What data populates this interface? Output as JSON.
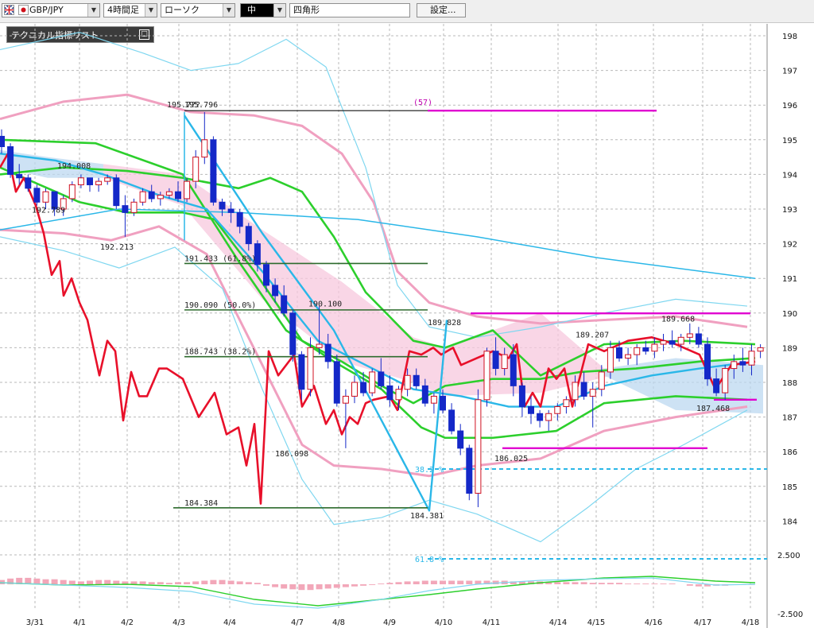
{
  "toolbar": {
    "symbol": "GBP/JPY",
    "timeframe": "4時間足",
    "chart_style": "ローソク",
    "size": "中",
    "shape": "四角形",
    "settings_label": "設定..."
  },
  "panel": {
    "label": "テクニカル指標リスト",
    "button": "□"
  },
  "chart_data": {
    "type": "candlestick",
    "x_tick_labels": [
      "3/31",
      "4/1",
      "4/2",
      "4/3",
      "4/4",
      "4/7",
      "4/8",
      "4/9",
      "4/10",
      "4/11",
      "4/14",
      "4/15",
      "4/16",
      "4/17",
      "4/18"
    ],
    "y_ticks": [
      198,
      197,
      196,
      195,
      194,
      193,
      192,
      191,
      190,
      189,
      188,
      187,
      186,
      185,
      184
    ],
    "macd_ticks": [
      "2.500",
      "-2.500"
    ],
    "price_labels": [
      {
        "text": "195.796",
        "price": 195.84
      },
      {
        "text": "195.7??",
        "price": 195.84
      },
      {
        "text": "194.008",
        "price": 194.1
      },
      {
        "text": "192.789",
        "price": 192.83
      },
      {
        "text": "192.213",
        "price": 192.1
      },
      {
        "text": "191.433 (61.8%)",
        "price": 191.43
      },
      {
        "text": "190.090 (50.0%)",
        "price": 190.09
      },
      {
        "text": "190.100",
        "price": 190.1
      },
      {
        "text": "188.743 (38.2%)",
        "price": 188.74
      },
      {
        "text": "186.098",
        "price": 186.1
      },
      {
        "text": "184.384",
        "price": 184.38
      },
      {
        "text": "184.381",
        "price": 184.35
      },
      {
        "text": "189.828",
        "price": 189.83
      },
      {
        "text": "189.207",
        "price": 189.2
      },
      {
        "text": "189.668",
        "price": 189.66
      },
      {
        "text": "186.025",
        "price": 186.05
      },
      {
        "text": "187.468",
        "price": 187.45
      },
      {
        "text": "(57)",
        "price": 195.96
      },
      {
        "text": "38.2 %",
        "price": 185.5
      },
      {
        "text": "61.8 %",
        "price": 2.6
      }
    ],
    "ohlc": [
      [
        195.1,
        195.3,
        194.6,
        194.8
      ],
      [
        194.8,
        194.9,
        193.9,
        194.0
      ],
      [
        194.0,
        194.3,
        193.7,
        193.9
      ],
      [
        193.9,
        194.0,
        193.5,
        193.6
      ],
      [
        193.6,
        193.7,
        193.1,
        193.2
      ],
      [
        193.2,
        193.6,
        193.0,
        193.5
      ],
      [
        193.5,
        193.5,
        192.8,
        193.0
      ],
      [
        193.0,
        193.4,
        192.8,
        193.3
      ],
      [
        193.3,
        193.8,
        193.2,
        193.7
      ],
      [
        193.7,
        194.0,
        193.6,
        193.9
      ],
      [
        193.9,
        193.9,
        193.5,
        193.7
      ],
      [
        193.7,
        193.9,
        193.5,
        193.8
      ],
      [
        193.8,
        194.0,
        193.7,
        193.9
      ],
      [
        193.9,
        194.0,
        193.0,
        193.1
      ],
      [
        193.1,
        193.4,
        192.2,
        192.9
      ],
      [
        192.9,
        193.3,
        192.8,
        193.2
      ],
      [
        193.2,
        193.6,
        193.1,
        193.5
      ],
      [
        193.5,
        193.7,
        193.2,
        193.3
      ],
      [
        193.3,
        193.5,
        193.1,
        193.4
      ],
      [
        193.4,
        193.6,
        193.3,
        193.5
      ],
      [
        193.5,
        193.8,
        193.2,
        193.3
      ],
      [
        193.3,
        193.9,
        193.2,
        193.8
      ],
      [
        193.8,
        194.7,
        193.6,
        194.5
      ],
      [
        194.5,
        195.8,
        194.3,
        195.0
      ],
      [
        195.0,
        195.1,
        193.1,
        193.2
      ],
      [
        193.2,
        193.3,
        192.8,
        193.0
      ],
      [
        193.0,
        193.2,
        192.6,
        192.9
      ],
      [
        192.9,
        193.0,
        192.3,
        192.5
      ],
      [
        192.5,
        192.6,
        191.8,
        192.0
      ],
      [
        192.0,
        192.1,
        191.2,
        191.4
      ],
      [
        191.4,
        191.5,
        190.6,
        190.8
      ],
      [
        190.8,
        191.0,
        190.3,
        190.5
      ],
      [
        190.5,
        190.8,
        189.9,
        190.0
      ],
      [
        190.0,
        190.1,
        188.6,
        188.8
      ],
      [
        188.8,
        188.9,
        187.5,
        187.8
      ],
      [
        187.8,
        189.3,
        187.6,
        189.0
      ],
      [
        189.0,
        190.2,
        188.8,
        189.1
      ],
      [
        189.1,
        189.4,
        188.4,
        188.6
      ],
      [
        188.6,
        188.8,
        187.3,
        187.4
      ],
      [
        187.4,
        187.8,
        186.1,
        187.6
      ],
      [
        187.6,
        188.2,
        187.4,
        188.0
      ],
      [
        188.0,
        188.3,
        187.6,
        187.7
      ],
      [
        187.7,
        188.4,
        187.6,
        188.3
      ],
      [
        188.3,
        188.7,
        187.8,
        187.9
      ],
      [
        187.9,
        188.2,
        187.3,
        187.5
      ],
      [
        187.5,
        187.9,
        187.2,
        187.8
      ],
      [
        187.8,
        188.4,
        187.6,
        188.2
      ],
      [
        188.2,
        188.4,
        187.8,
        187.9
      ],
      [
        187.9,
        188.1,
        187.3,
        187.4
      ],
      [
        187.4,
        187.7,
        187.1,
        187.6
      ],
      [
        187.6,
        187.8,
        187.1,
        187.2
      ],
      [
        187.2,
        187.4,
        186.5,
        186.6
      ],
      [
        186.6,
        186.8,
        185.9,
        186.1
      ],
      [
        186.1,
        186.2,
        184.6,
        184.8
      ],
      [
        184.8,
        187.8,
        184.4,
        187.5
      ],
      [
        187.5,
        189.0,
        187.3,
        188.9
      ],
      [
        188.9,
        189.3,
        188.2,
        188.4
      ],
      [
        188.4,
        189.0,
        188.2,
        188.8
      ],
      [
        188.8,
        189.1,
        187.6,
        187.9
      ],
      [
        187.9,
        188.0,
        187.0,
        187.3
      ],
      [
        187.3,
        187.6,
        186.8,
        187.1
      ],
      [
        187.1,
        187.2,
        186.7,
        186.9
      ],
      [
        186.9,
        187.2,
        186.6,
        187.1
      ],
      [
        187.1,
        187.4,
        186.9,
        187.3
      ],
      [
        187.3,
        187.6,
        187.1,
        187.5
      ],
      [
        187.5,
        188.2,
        187.3,
        188.0
      ],
      [
        188.0,
        188.3,
        187.5,
        187.6
      ],
      [
        187.6,
        188.0,
        186.7,
        187.8
      ],
      [
        187.8,
        188.5,
        187.6,
        188.3
      ],
      [
        188.3,
        189.2,
        188.1,
        189.0
      ],
      [
        189.0,
        189.2,
        188.6,
        188.7
      ],
      [
        188.7,
        189.0,
        188.5,
        188.8
      ],
      [
        188.8,
        189.1,
        188.5,
        189.0
      ],
      [
        189.0,
        189.2,
        188.8,
        188.9
      ],
      [
        188.9,
        189.3,
        188.7,
        189.1
      ],
      [
        189.1,
        189.4,
        188.9,
        189.2
      ],
      [
        189.2,
        189.5,
        189.0,
        189.1
      ],
      [
        189.1,
        189.4,
        188.9,
        189.3
      ],
      [
        189.3,
        189.7,
        189.1,
        189.4
      ],
      [
        189.4,
        189.6,
        189.0,
        189.1
      ],
      [
        189.1,
        189.3,
        187.9,
        188.1
      ],
      [
        188.1,
        188.4,
        187.6,
        187.7
      ],
      [
        187.7,
        188.5,
        187.5,
        188.4
      ],
      [
        188.4,
        188.8,
        188.1,
        188.6
      ],
      [
        188.6,
        189.0,
        188.3,
        188.5
      ],
      [
        188.5,
        189.1,
        188.2,
        188.9
      ],
      [
        188.9,
        189.1,
        188.7,
        189.0
      ]
    ],
    "series": [
      {
        "name": "ボリンジャーバンド",
        "color": "#f0a0c0",
        "width": 3
      },
      {
        "name": "ボリンジャーバンド",
        "color": "#7fd7f0",
        "width": 1.2
      },
      {
        "name": "移動平均",
        "color": "#2ccf2c",
        "width": 2.6
      },
      {
        "name": "移動平均",
        "color": "#2ab7e8",
        "width": 2.4
      },
      {
        "name": "一目均衡表",
        "color": "#e8102a",
        "width": 2.6
      }
    ],
    "y_range": [
      183.4,
      198.6
    ],
    "grid": true
  }
}
